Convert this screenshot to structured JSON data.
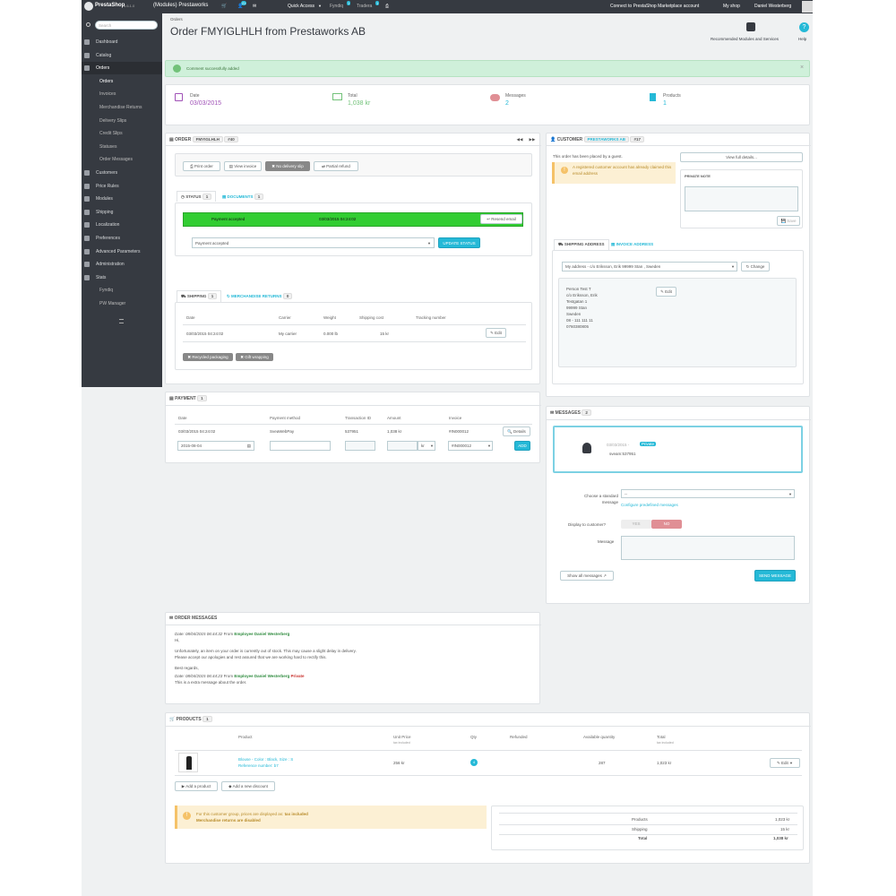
{
  "topbar": {
    "brand": "PrestaShop",
    "version": "1.6.1.0",
    "shop_context": "(Modules) Prestaworks",
    "cart_count": "1",
    "customer_count": "21",
    "quick_access": "Quick Access",
    "fyndiq": "Fyndiq",
    "fyndiq_count": "1",
    "tradera": "Tradera",
    "tradera_count": "1",
    "connect": "Connect to PrestaShop Marketplace account",
    "my_shop": "My shop",
    "employee": "Daniel Westerberg"
  },
  "sidebar": {
    "search_placeholder": "Search",
    "items": [
      "Dashboard",
      "Catalog",
      "Orders"
    ],
    "orders_sub": [
      "Orders",
      "Invoices",
      "Merchandise Returns",
      "Delivery Slips",
      "Credit Slips",
      "Statuses",
      "Order Messages"
    ],
    "items_after": [
      "Customers",
      "Price Rules",
      "Modules",
      "Shipping",
      "Localization",
      "Preferences",
      "Advanced Parameters",
      "Administration",
      "Stats"
    ],
    "extra": [
      "Fyndiq",
      "PW Manager"
    ]
  },
  "header": {
    "breadcrumb": "Orders",
    "title": "Order FMYIGLHLH from Prestaworks AB",
    "recommended": "Recommended Modules and Services",
    "help": "Help"
  },
  "alert": {
    "text": "Comment successfully added",
    "close": "×"
  },
  "kpis": {
    "date_label": "Date",
    "date_value": "03/03/2015",
    "total_label": "Total",
    "total_value": "1,038 kr",
    "messages_label": "Messages",
    "messages_value": "2",
    "products_label": "Products",
    "products_value": "1"
  },
  "order": {
    "heading": "ORDER",
    "reference": "FMYIGLHLH",
    "id": "#40",
    "buttons": {
      "print": "Print order",
      "view_invoice": "View invoice",
      "no_delivery": "No delivery slip",
      "partial_refund": "Partial refund"
    },
    "tab_status": "STATUS",
    "tab_status_count": "1",
    "tab_documents": "DOCUMENTS",
    "tab_documents_count": "1",
    "status_name": "Payment accepted",
    "status_date": "03/03/2015 04:24:02",
    "resend_email": "Resend email",
    "status_select": "Payment accepted",
    "update_status": "UPDATE STATUS",
    "tab_shipping": "SHIPPING",
    "tab_shipping_count": "1",
    "tab_returns": "MERCHANDISE RETURNS",
    "tab_returns_count": "0",
    "ship_headers": [
      "Date",
      "Carrier",
      "Weight",
      "Shipping cost",
      "Tracking number"
    ],
    "ship_row": [
      "03/03/2015 04:24:02",
      "My carrier",
      "0.000 lb",
      "15 kr",
      ""
    ],
    "ship_edit": "Edit",
    "recycled": "Recycled packaging",
    "gift": "Gift wrapping"
  },
  "customer": {
    "heading": "CUSTOMER",
    "name": "PRESTAWORKS AB",
    "id": "#17",
    "guest_text": "This order has been placed by a guest.",
    "warning": "A registered customer account has already claimed this email address",
    "view_details": "View full details...",
    "private_note": "PRIVATE NOTE",
    "save": "Save",
    "tab_shipping_address": "SHIPPING ADDRESS",
    "tab_invoice_address": "INVOICE ADDRESS",
    "address_select": "My address - c/o Eriksson, Erik 99999 Stan , Sweden",
    "change": "Change",
    "edit": "Edit",
    "address_lines": [
      "Person Test T",
      "c/o Eriksson, Erik",
      "Testgatan 1",
      "99999 Stan",
      "Sweden",
      "08 - 111 111 11",
      "0760380805"
    ]
  },
  "payment": {
    "heading": "PAYMENT",
    "count": "1",
    "headers": [
      "Date",
      "Payment method",
      "Transaction ID",
      "Amount",
      "Invoice"
    ],
    "row": [
      "03/03/2015 04:24:02",
      "SveaWebPay",
      "537951",
      "1,038 kr",
      "#IN000012"
    ],
    "details": "Details",
    "new_date": "2015-08-04",
    "currency": "kr",
    "new_invoice": "#IN000012",
    "add": "ADD"
  },
  "messages": {
    "heading": "MESSAGES",
    "count": "2",
    "msg_date": "03/03/2015 -",
    "msg_private": "Private",
    "msg_text": "sveam:537951",
    "choose_label": "Choose a standard message",
    "choose_value": "--",
    "configure": "Configure predefined messages",
    "display_label": "Display to customer?",
    "yes": "YES",
    "no": "NO",
    "message_label": "Message",
    "show_all": "Show all messages",
    "send": "SEND MESSAGE"
  },
  "order_messages": {
    "heading": "ORDER MESSAGES",
    "m1_date": "Date: 08/04/2015 06:44:32",
    "m1_from": "From",
    "m1_author": "Employee Daniel Westerberg",
    "m1_lines": [
      "Hi,",
      "",
      "Unfortunately, an item on your order is currently out of stock. This may cause a slight delay in delivery.",
      "Please accept our apologies and rest assured that we are working hard to rectify this.",
      "",
      "Best regards,"
    ],
    "m2_date": "Date: 08/04/2015 06:44:23",
    "m2_from": "From",
    "m2_author": "Employee Daniel Westerberg",
    "m2_private": "Private",
    "m2_text": "This is a extra message about the order."
  },
  "products": {
    "heading": "PRODUCTS",
    "count": "1",
    "headers": [
      "Product",
      "Unit Price",
      "Qty",
      "Refunded",
      "Available quantity",
      "Total"
    ],
    "unit_sub": "tax included",
    "total_sub": "tax included",
    "name": "Blouse - Color : Black, Size : S",
    "ref": "Reference number: b7",
    "unit_price": "256 kr",
    "qty": "4",
    "available": "287",
    "total": "1,023 kr",
    "edit": "Edit",
    "add_product": "Add a product",
    "add_discount": "Add a new discount",
    "warn1_pre": "For this customer group, prices are displayed as:",
    "warn1_strong": "tax included",
    "warn2": "Merchandise returns are disabled",
    "sum_products_label": "Products",
    "sum_products": "1,023 kr",
    "sum_shipping_label": "Shipping",
    "sum_shipping": "15 kr",
    "sum_total_label": "Total",
    "sum_total": "1,038 kr"
  }
}
